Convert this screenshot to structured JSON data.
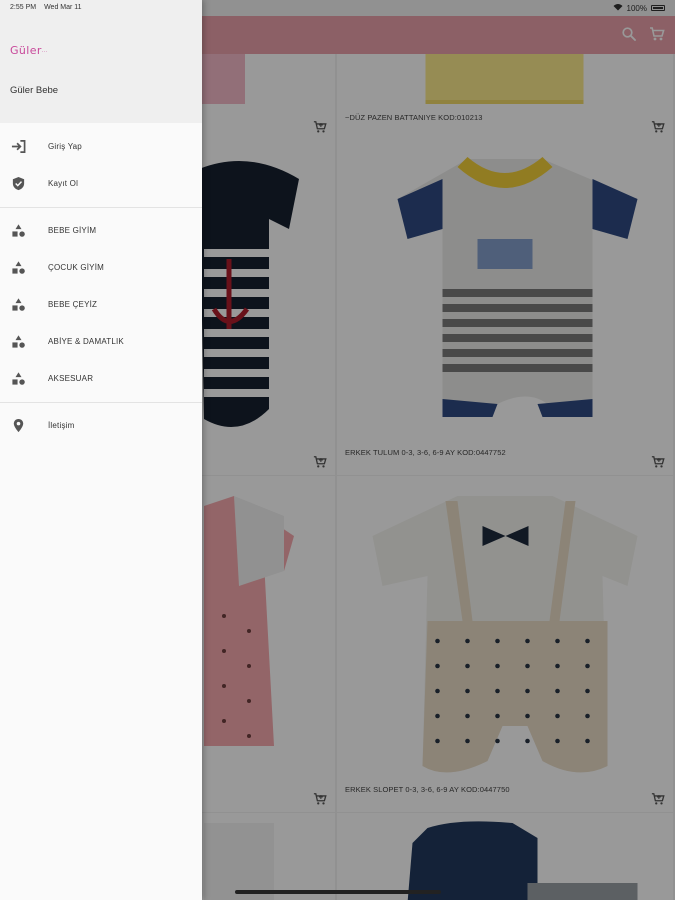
{
  "status": {
    "time": "2:55 PM",
    "date": "Wed Mar 11",
    "battery": "100%"
  },
  "app": {
    "brand_color": "#e9a0aa",
    "products": [
      {
        "label": ""
      },
      {
        "label": "~DÜZ PAZEN BATTANIYE KOD:010213"
      },
      {
        "label": ""
      },
      {
        "label": "ERKEK TULUM 0-3, 3-6, 6-9 AY KOD:0447752"
      },
      {
        "label": ""
      },
      {
        "label": "ERKEK SLOPET 0-3, 3-6, 6-9 AY KOD:0447750"
      },
      {
        "label": ""
      },
      {
        "label": ""
      }
    ]
  },
  "drawer": {
    "logo": "Güler",
    "title": "Güler Bebe",
    "account": [
      {
        "label": "Giriş Yap",
        "icon": "login-icon"
      },
      {
        "label": "Kayıt Ol",
        "icon": "shield-check-icon"
      }
    ],
    "categories": [
      {
        "label": "BEBE GİYİM",
        "icon": "shapes-icon"
      },
      {
        "label": "ÇOCUK GİYİM",
        "icon": "shapes-icon"
      },
      {
        "label": "BEBE ÇEYİZ",
        "icon": "shapes-icon"
      },
      {
        "label": "ABİYE & DAMATLIK",
        "icon": "shapes-icon"
      },
      {
        "label": "AKSESUAR",
        "icon": "shapes-icon"
      }
    ],
    "contact": [
      {
        "label": "İletişim",
        "icon": "location-pin-icon"
      }
    ]
  }
}
